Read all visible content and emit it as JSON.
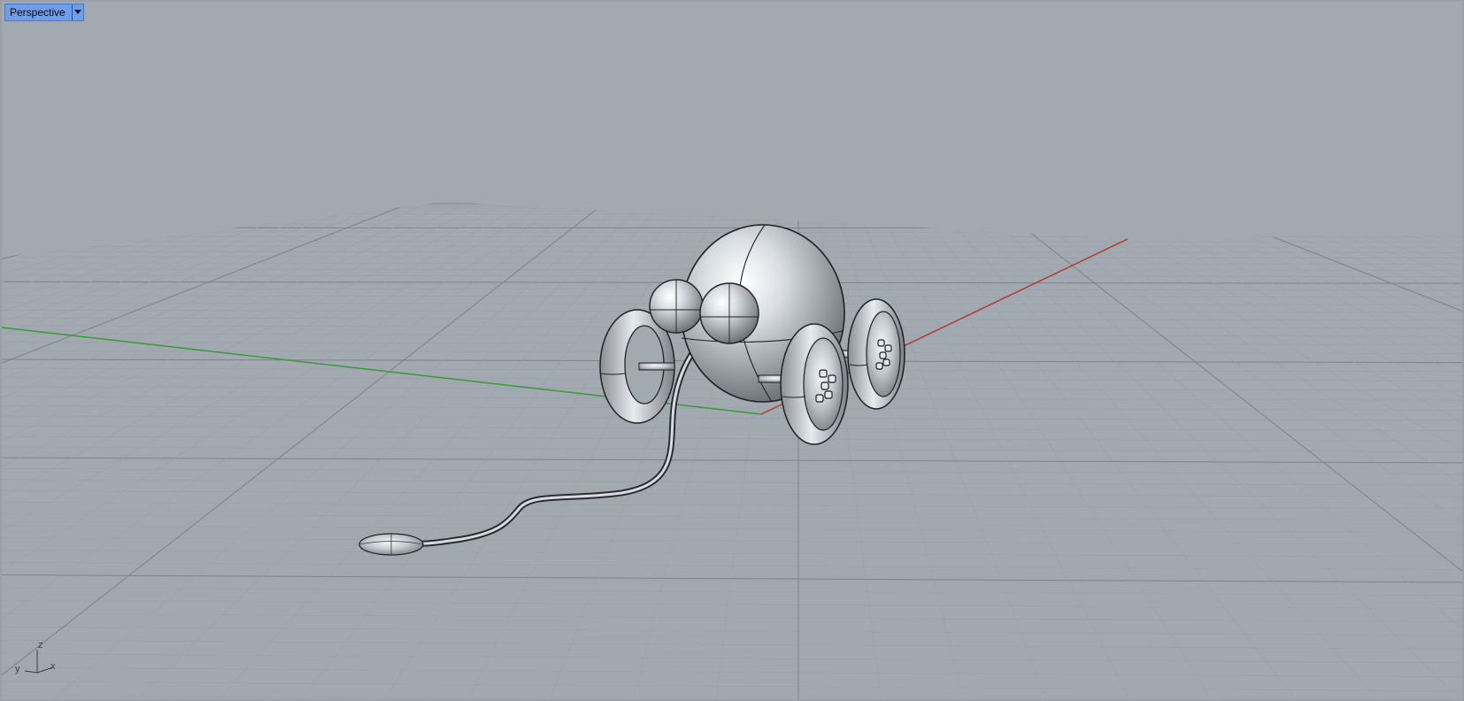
{
  "viewport": {
    "title": "Perspective",
    "dropdown_icon": "triangle-down-icon"
  },
  "axis_widget": {
    "z_label": "z",
    "y_label": "y",
    "x_label": "x"
  },
  "colors": {
    "background": "#a3a9b1",
    "grid_minor": "#9aa0a8",
    "grid_major": "#7d838b",
    "x_axis": "#b03a32",
    "y_axis": "#3a9a3a",
    "title_active": "#6f9de8"
  }
}
